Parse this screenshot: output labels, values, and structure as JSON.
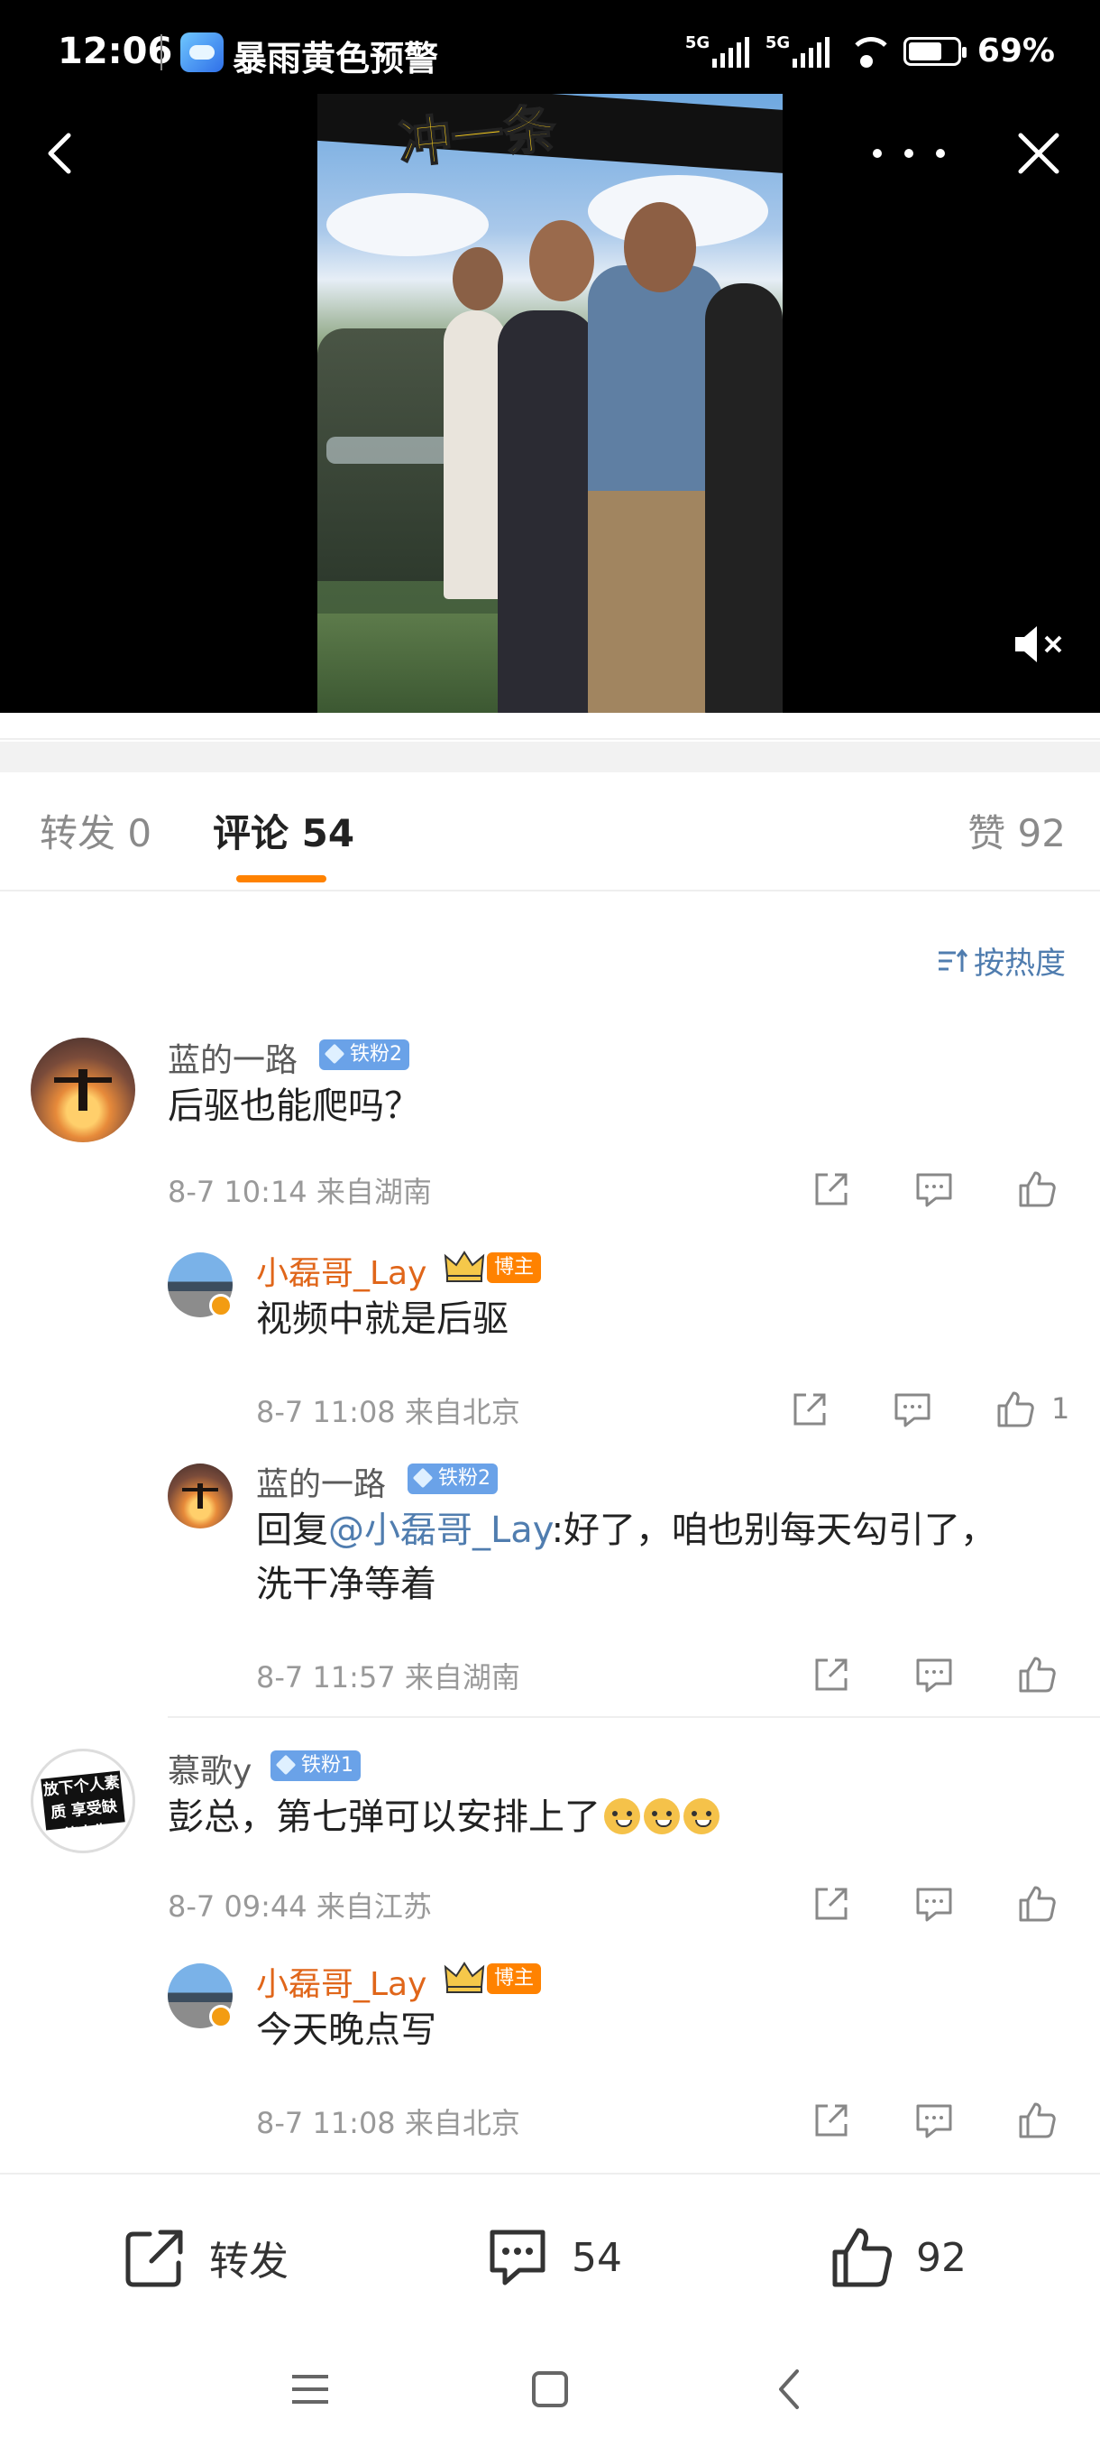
{
  "status_bar": {
    "time": "12:06",
    "notification_title": "暴雨黄色预警",
    "network1": "5G",
    "network2": "5G",
    "battery": "69%",
    "battery_level": 0.69
  },
  "video": {
    "caption": "冲一条",
    "mute_icon": "speaker-muted-icon"
  },
  "tabs": {
    "repost": "转发 0",
    "comments": "评论 54",
    "likes": "赞 92"
  },
  "sort_label": "按热度",
  "comments": [
    {
      "user": "蓝的一路",
      "badge": "铁粉2",
      "text": "后驱也能爬吗？",
      "meta": "8-7 10:14  来自湖南",
      "likes": ""
    },
    {
      "user": "小磊哥_Lay",
      "badge": "博主",
      "text": "视频中就是后驱",
      "meta": "8-7 11:08  来自北京",
      "likes": "1"
    },
    {
      "user": "蓝的一路",
      "badge": "铁粉2",
      "reply_prefix": "回复",
      "mention": "@小磊哥_Lay",
      "text_line1": ":好了，咱也别每天勾引了，",
      "text_line2": "洗干净等着",
      "meta": "8-7 11:57  来自湖南",
      "likes": ""
    },
    {
      "user": "慕歌y",
      "badge": "铁粉1",
      "avatar_text": "放下个人素质 享受缺德人生",
      "text": "彭总，第七弹可以安排上了",
      "meta": "8-7 09:44  来自江苏",
      "likes": ""
    },
    {
      "user": "小磊哥_Lay",
      "badge": "博主",
      "text": "今天晚点写",
      "meta": "8-7 11:08  来自北京",
      "likes": ""
    }
  ],
  "action_bar": {
    "repost": "转发",
    "comments": "54",
    "likes": "92"
  }
}
